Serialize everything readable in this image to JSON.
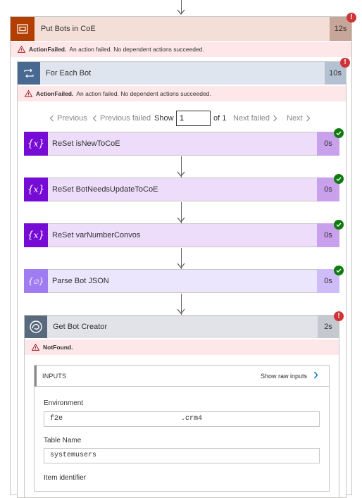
{
  "outer_action": {
    "title": "Put Bots in CoE",
    "duration": "12s",
    "status_badge": "!",
    "error_code": "ActionFailed.",
    "error_message": "An action failed. No dependent actions succeeded."
  },
  "loop": {
    "title": "For Each Bot",
    "duration": "10s",
    "status_badge": "!",
    "error_code": "ActionFailed.",
    "error_message": "An action failed. No dependent actions succeeded."
  },
  "pager": {
    "previous": "Previous",
    "previous_failed": "Previous failed",
    "show_label": "Show",
    "page_value": "1",
    "of_label": "of 1",
    "next_failed": "Next failed",
    "next": "Next"
  },
  "steps": [
    {
      "title": "ReSet isNewToCoE",
      "duration": "0s",
      "icon": "variable-icon"
    },
    {
      "title": "ReSet BotNeedsUpdateToCoE",
      "duration": "0s",
      "icon": "variable-icon"
    },
    {
      "title": "ReSet varNumberConvos",
      "duration": "0s",
      "icon": "variable-icon"
    },
    {
      "title": "Parse Bot JSON",
      "duration": "0s",
      "icon": "data-operation-icon"
    }
  ],
  "get_creator": {
    "title": "Get Bot Creator",
    "duration": "2s",
    "status_badge": "!",
    "error_code": "NotFound."
  },
  "inputs": {
    "title": "INPUTS",
    "raw_link": "Show raw inputs",
    "environment_label": "Environment",
    "environment_value_start": "f2e",
    "environment_value_end": ".crm4",
    "table_label": "Table Name",
    "table_value": "systemusers",
    "item_label": "Item identifier"
  },
  "colors": {
    "error": "#d13438",
    "success": "#107c10",
    "variable_purple": "#770bd6",
    "parse_purple": "#9f7cf2",
    "outer_brown": "#b23f00",
    "loop_blue": "#486991"
  }
}
